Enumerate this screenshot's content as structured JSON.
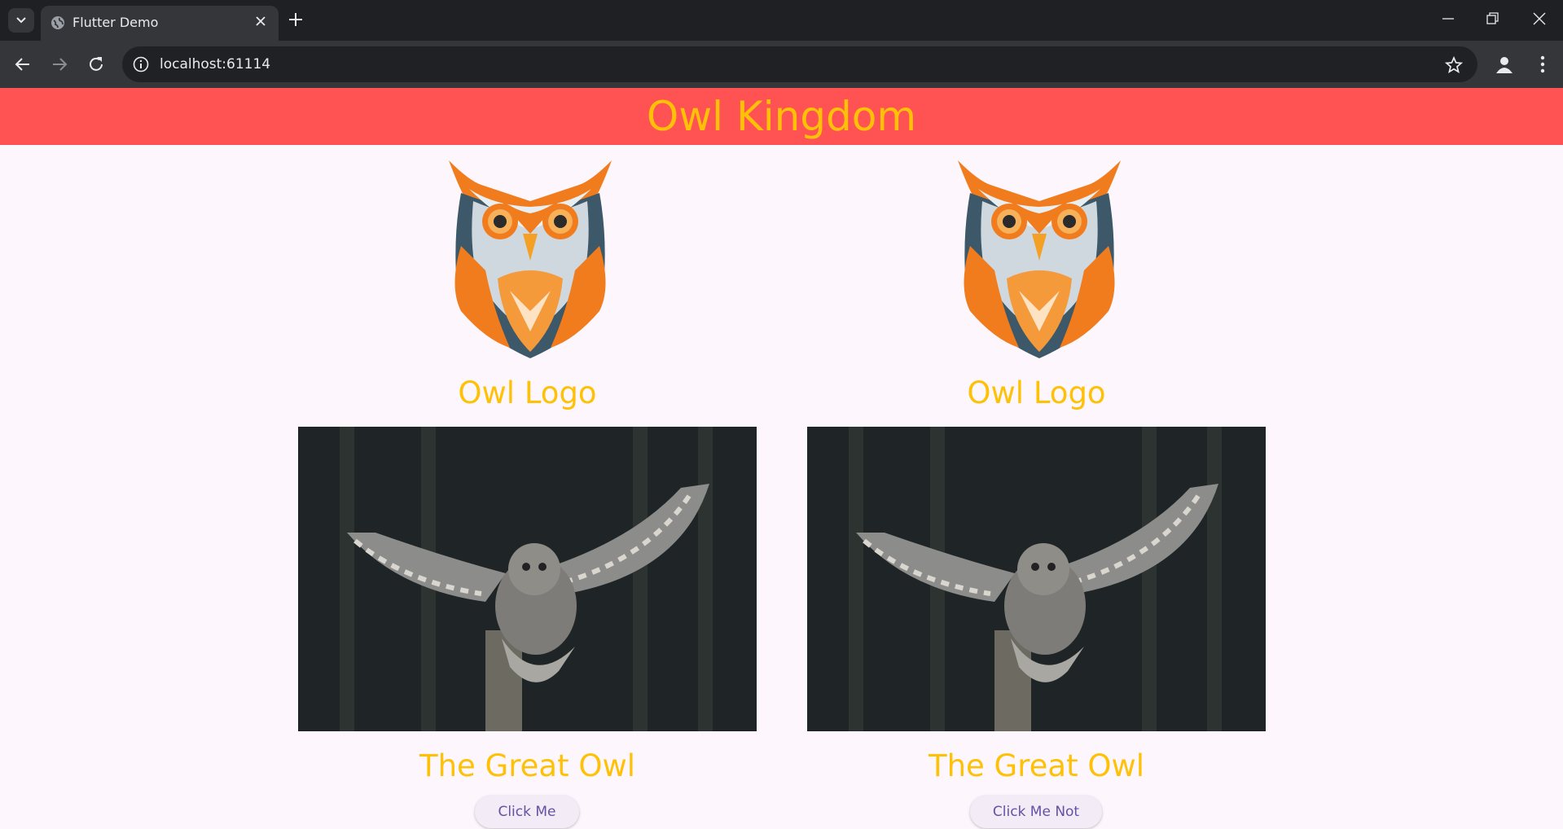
{
  "browser": {
    "tab_title": "Flutter Demo",
    "url": "localhost:61114"
  },
  "app": {
    "title": "Owl Kingdom",
    "colors": {
      "appbar": "#ff5252",
      "accent": "#ffc107",
      "button_text": "#6750a4"
    }
  },
  "columns": [
    {
      "logo_caption": "Owl Logo",
      "photo_caption": "The Great Owl",
      "button_label": "Click Me"
    },
    {
      "logo_caption": "Owl Logo",
      "photo_caption": "The Great Owl",
      "button_label": "Click Me Not"
    }
  ],
  "icons": [
    "tab-list-icon",
    "globe-icon",
    "close-icon",
    "plus-icon",
    "minimize-icon",
    "restore-icon",
    "back-icon",
    "forward-icon",
    "reload-icon",
    "info-icon",
    "star-icon",
    "profile-icon",
    "more-icon",
    "owl-logo-icon"
  ]
}
